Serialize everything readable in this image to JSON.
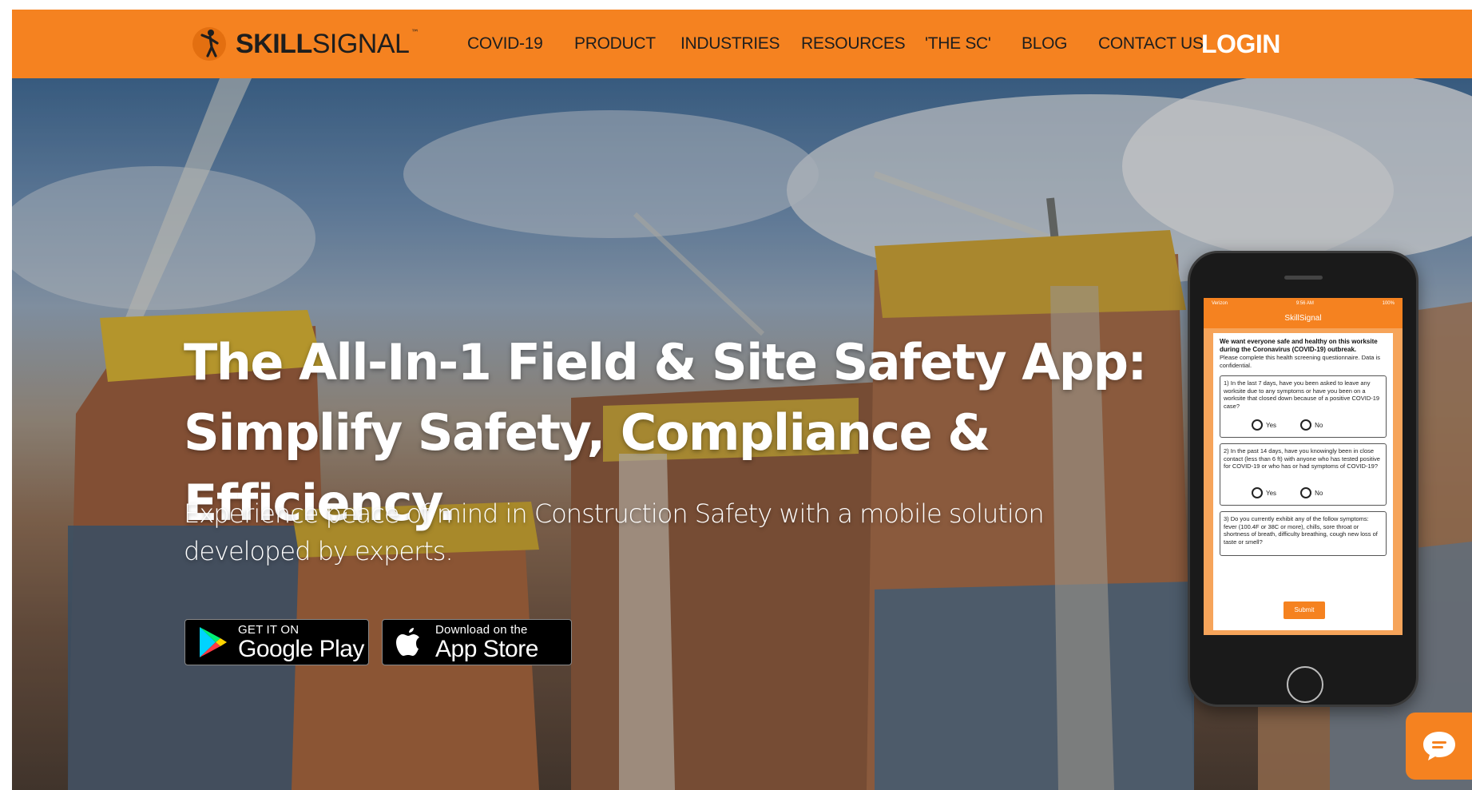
{
  "brand": {
    "name_bold": "SKILL",
    "name_regular": "SIGNAL",
    "trademark": "™",
    "color": "#f58220"
  },
  "nav": {
    "items": [
      "COVID-19",
      "PRODUCT",
      "INDUSTRIES",
      "RESOURCES",
      "'THE SC'",
      "BLOG",
      "CONTACT US"
    ],
    "login": "LOGIN"
  },
  "hero": {
    "title_line1": "The All-In-1 Field & Site Safety App:",
    "title_line2": "Simplify Safety, Compliance & Efficiency.",
    "subtitle_line1": "Experience peace of mind in Construction Safety with a mobile solution",
    "subtitle_line2": "developed by experts."
  },
  "badges": {
    "google_small": "GET IT ON",
    "google_big": "Google Play",
    "apple_small": "Download on the",
    "apple_big": "App Store"
  },
  "phone_screen": {
    "status_left": "Verizon",
    "status_center": "9:56 AM",
    "status_right": "100%",
    "app_title": "SkillSignal",
    "intro": "We want everyone safe and healthy on this worksite during the Coronavirus (COVID-19) outbreak.",
    "note": "Please complete this health screening questionnaire. Data is confidential.",
    "q1": "1) In the last 7 days, have you been asked to leave any worksite due to any symptoms or have you been on a worksite that closed down because of a positive COVID-19 case?",
    "q2": "2) In the past 14 days, have you knowingly been in close contact (less than 6 ft) with anyone who has tested positive for COVID-19 or who has or had symptoms of COVID-19?",
    "q3": "3) Do you currently exhibit any of the follow symptoms: fever (100.4F or 38C or more), chills, sore throat or shortness of breath, difficulty breathing, cough new loss of taste or smell?",
    "yes": "Yes",
    "no": "No",
    "submit": "Submit"
  },
  "icons": {
    "logo": "worker-figure-icon",
    "google_play": "google-play-icon",
    "apple": "apple-icon",
    "chat": "chat-icon"
  }
}
